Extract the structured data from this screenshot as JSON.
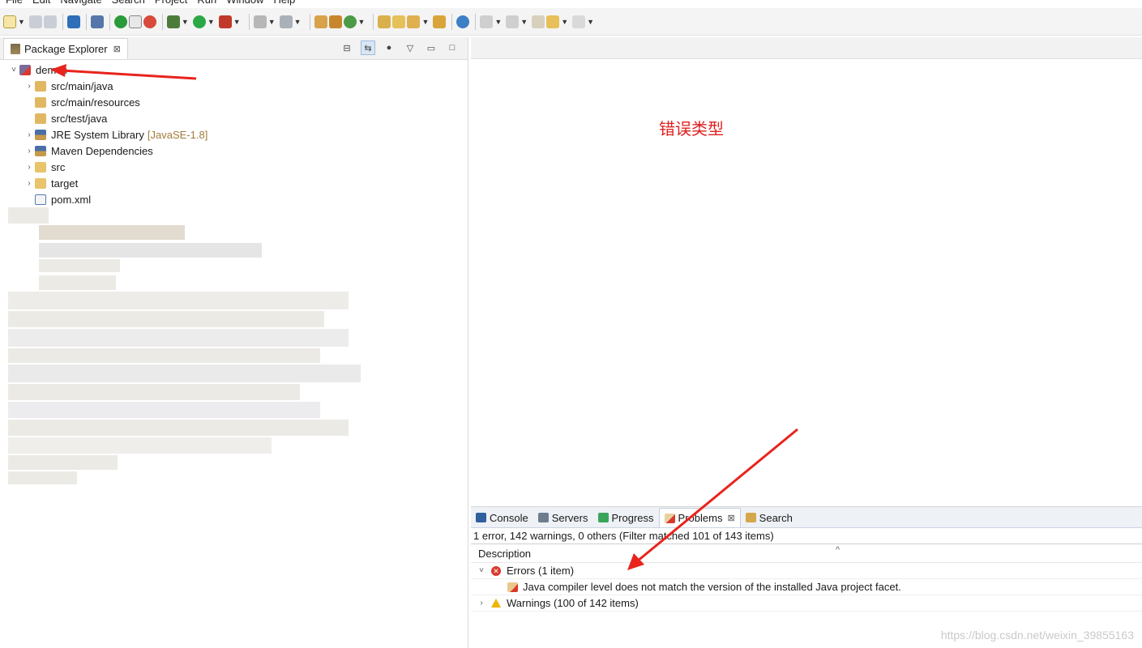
{
  "menu": [
    "File",
    "Edit",
    "Navigate",
    "Search",
    "Project",
    "Run",
    "Window",
    "Help"
  ],
  "package_explorer": {
    "tab_label": "Package Explorer",
    "close_glyph": "⊠",
    "tree": [
      {
        "label": "demos",
        "twisty": "˅",
        "icon": "maven-project-icon"
      },
      {
        "label": "src/main/java",
        "twisty": "›",
        "icon": "source-folder-icon"
      },
      {
        "label": "src/main/resources",
        "twisty": "",
        "icon": "source-folder-icon"
      },
      {
        "label": "src/test/java",
        "twisty": "",
        "icon": "source-folder-icon"
      },
      {
        "label": "JRE System Library",
        "decoration": "[JavaSE-1.8]",
        "twisty": "›",
        "icon": "library-icon"
      },
      {
        "label": "Maven Dependencies",
        "twisty": "›",
        "icon": "library-icon"
      },
      {
        "label": "src",
        "twisty": "›",
        "icon": "folder-icon"
      },
      {
        "label": "target",
        "twisty": "›",
        "icon": "folder-icon"
      },
      {
        "label": "pom.xml",
        "twisty": "",
        "icon": "maven-file-icon"
      }
    ]
  },
  "editor": {
    "annotation": "错误类型"
  },
  "bottom_tabs": [
    {
      "label": "Console",
      "icon": "console-icon",
      "active": false
    },
    {
      "label": "Servers",
      "icon": "servers-icon",
      "active": false
    },
    {
      "label": "Progress",
      "icon": "progress-icon",
      "active": false
    },
    {
      "label": "Problems",
      "icon": "problems-icon",
      "active": true
    },
    {
      "label": "Search",
      "icon": "search-icon",
      "active": false
    }
  ],
  "problems": {
    "summary": "1 error, 142 warnings, 0 others (Filter matched 101 of 143 items)",
    "column_header": "Description",
    "errors_group": "Errors (1 item)",
    "error_item": "Java compiler level does not match the version of the installed Java project facet.",
    "warnings_group": "Warnings (100 of 142 items)"
  },
  "watermark": "https://blog.csdn.net/weixin_39855163",
  "colors": {
    "annotation": "#e02020",
    "arrow": "#e8241c",
    "error": "#d9392e",
    "warning": "#f0b400",
    "decoration": "#a27b3b"
  }
}
